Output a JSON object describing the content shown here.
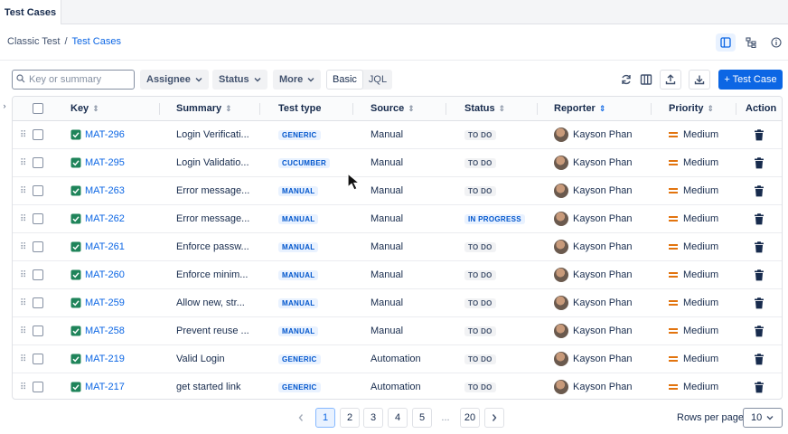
{
  "tab": {
    "label": "Test Cases"
  },
  "breadcrumb": {
    "parent": "Classic Test",
    "separator": "/",
    "current": "Test Cases"
  },
  "toolbar": {
    "search_placeholder": "Key or summary",
    "filters": [
      "Assignee",
      "Status",
      "More"
    ],
    "mode_basic": "Basic",
    "mode_jql": "JQL",
    "add_label": "+ Test Case"
  },
  "table": {
    "headers": [
      "Key",
      "Summary",
      "Test type",
      "Source",
      "Status",
      "Reporter",
      "Priority",
      "Action"
    ],
    "rows": [
      {
        "key": "MAT-296",
        "summary": "Login Verificati...",
        "type": "GENERIC",
        "source": "Manual",
        "status": "TO DO",
        "reporter": "Kayson Phan",
        "priority": "Medium"
      },
      {
        "key": "MAT-295",
        "summary": "Login Validatio...",
        "type": "CUCUMBER",
        "source": "Manual",
        "status": "TO DO",
        "reporter": "Kayson Phan",
        "priority": "Medium"
      },
      {
        "key": "MAT-263",
        "summary": "Error message...",
        "type": "MANUAL",
        "source": "Manual",
        "status": "TO DO",
        "reporter": "Kayson Phan",
        "priority": "Medium"
      },
      {
        "key": "MAT-262",
        "summary": "Error message...",
        "type": "MANUAL",
        "source": "Manual",
        "status": "IN PROGRESS",
        "reporter": "Kayson Phan",
        "priority": "Medium"
      },
      {
        "key": "MAT-261",
        "summary": "Enforce passw...",
        "type": "MANUAL",
        "source": "Manual",
        "status": "TO DO",
        "reporter": "Kayson Phan",
        "priority": "Medium"
      },
      {
        "key": "MAT-260",
        "summary": "Enforce minim...",
        "type": "MANUAL",
        "source": "Manual",
        "status": "TO DO",
        "reporter": "Kayson Phan",
        "priority": "Medium"
      },
      {
        "key": "MAT-259",
        "summary": "Allow new, str...",
        "type": "MANUAL",
        "source": "Manual",
        "status": "TO DO",
        "reporter": "Kayson Phan",
        "priority": "Medium"
      },
      {
        "key": "MAT-258",
        "summary": "Prevent reuse ...",
        "type": "MANUAL",
        "source": "Manual",
        "status": "TO DO",
        "reporter": "Kayson Phan",
        "priority": "Medium"
      },
      {
        "key": "MAT-219",
        "summary": "Valid Login",
        "type": "GENERIC",
        "source": "Automation",
        "status": "TO DO",
        "reporter": "Kayson Phan",
        "priority": "Medium"
      },
      {
        "key": "MAT-217",
        "summary": "get started link",
        "type": "GENERIC",
        "source": "Automation",
        "status": "TO DO",
        "reporter": "Kayson Phan",
        "priority": "Medium"
      }
    ]
  },
  "pagination": {
    "pages": [
      "1",
      "2",
      "3",
      "4",
      "5"
    ],
    "ellipsis": "...",
    "last": "20",
    "current": "1",
    "rows_per_page_label": "Rows per page",
    "rows_per_page": "10"
  },
  "colors": {
    "accent": "#0c66e4",
    "status_in_progress": "#e9f2ff",
    "status_todo": "#f1f2f4",
    "priority_medium": "#e2740f"
  }
}
